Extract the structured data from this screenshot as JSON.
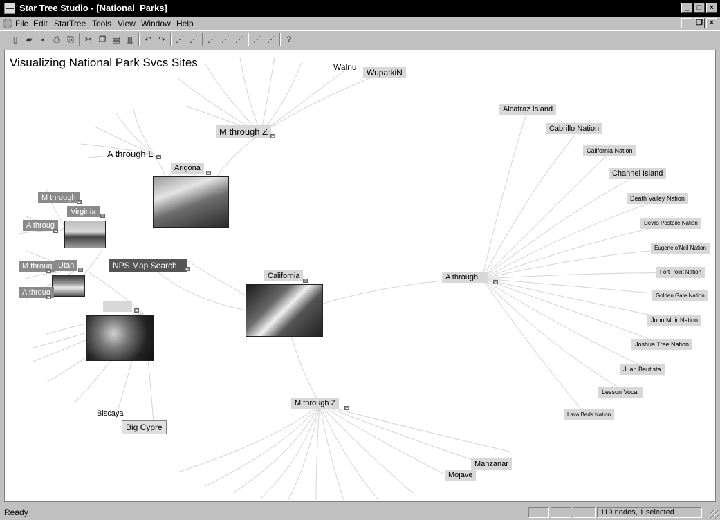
{
  "window": {
    "title": "Star Tree Studio - [National_Parks]",
    "controls": {
      "minimize": "_",
      "maximize": "□",
      "close": "×"
    }
  },
  "menubar": {
    "items": [
      "File",
      "Edit",
      "StarTree",
      "Tools",
      "View",
      "Window",
      "Help"
    ],
    "mdi_controls": {
      "minimize": "_",
      "restore": "❐",
      "close": "×"
    }
  },
  "toolbar": {
    "buttons": [
      "new-icon",
      "open-icon",
      "save-icon",
      "print-icon",
      "print-preview-icon",
      "cut-icon",
      "copy-icon",
      "paste-icon",
      "paste-special-icon",
      "undo-icon",
      "redo-icon",
      "tree-layout-1-icon",
      "tree-layout-2-icon",
      "tree-layout-3-icon",
      "tree-layout-4-icon",
      "tree-layout-5-icon",
      "tree-layout-6-icon",
      "tree-layout-7-icon",
      "help-icon"
    ]
  },
  "canvas": {
    "title": "Visualizing National Park Svcs Sites",
    "nodes": {
      "root": "California",
      "a_through_l_right": "A through L",
      "m_through_z_bottom": "M through Z",
      "nps_map_search": "NPS Map Search",
      "m_through_z_top": "M through Z",
      "a_through_l_top": "A through L",
      "arigona": "Arigona",
      "walnu": "Walnu",
      "wupatkin": "WupatkiN",
      "m_through_left": "M through",
      "virginia": "Virginia",
      "a_throug_left": "A throug",
      "m_throug_left2": "M throug",
      "utah": "Utah",
      "a_throug_left2": "A throug",
      "biscaya": "Biscaya",
      "big_cypre": "Big Cypre",
      "manzanar": "Manzanar",
      "mojave": "Mojave",
      "ca_sites": [
        "Alcatraz Island",
        "Cabrillo Nation",
        "California Nation",
        "Channel Island",
        "Death Valley Nation",
        "Devils Postpile Nation",
        "Eugene o'Neil Nation",
        "Fort Point Nation",
        "Golden Gate Nation",
        "John Muir Nation",
        "Joshua Tree Nation",
        "Juan Bautista",
        "Lesson Vocal",
        "Lava Beds Nation"
      ]
    }
  },
  "statusbar": {
    "status": "Ready",
    "count": "119 nodes, 1 selected"
  }
}
